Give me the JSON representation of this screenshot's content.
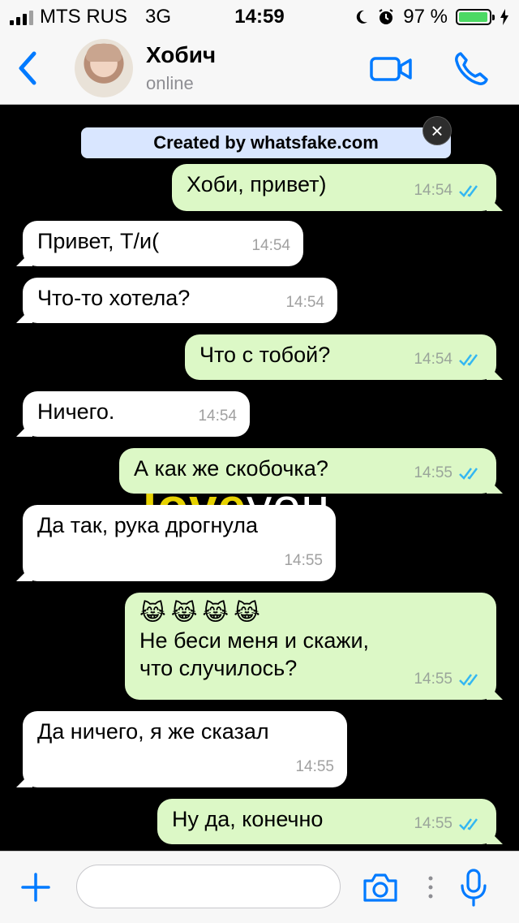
{
  "status_bar": {
    "carrier": "MTS RUS",
    "network": "3G",
    "time": "14:59",
    "battery_percent": "97 %",
    "battery_level": 0.97
  },
  "header": {
    "contact_name": "Хобич",
    "contact_status": "online"
  },
  "chat": {
    "banner": "Created by whatsfake.com",
    "wallpaper_text_1": "love",
    "wallpaper_text_2": "you",
    "messages": [
      {
        "direction": "out",
        "text": "Хоби, привет)",
        "time": "14:54",
        "read": true
      },
      {
        "direction": "in",
        "text": "Привет, Т/и(",
        "time": "14:54"
      },
      {
        "direction": "in",
        "text": "Что-то хотела?",
        "time": "14:54"
      },
      {
        "direction": "out",
        "text": "Что с тобой?",
        "time": "14:54",
        "read": true
      },
      {
        "direction": "in",
        "text": "Ничего.",
        "time": "14:54"
      },
      {
        "direction": "out",
        "text": "А как же скобочка?",
        "time": "14:55",
        "read": true
      },
      {
        "direction": "in",
        "text": "Да так, рука дрогнула",
        "time": "14:55"
      },
      {
        "direction": "out",
        "emoji": "😹😹😹😹",
        "line1": "Не беси меня и скажи,",
        "line2": "что случилось?",
        "time": "14:55",
        "read": true
      },
      {
        "direction": "in",
        "text": "Да ничего, я же сказал",
        "time": "14:55"
      },
      {
        "direction": "out",
        "text": "Ну да, конечно",
        "time": "14:55",
        "read": true
      }
    ]
  },
  "input_bar": {
    "message_value": ""
  },
  "colors": {
    "accent": "#007aff",
    "outgoing_bubble": "#dcf8c6",
    "incoming_bubble": "#ffffff",
    "read_ticks": "#34b7f1",
    "chat_background": "#000000",
    "banner_background": "#d9e6ff"
  },
  "icons": [
    "signal-icon",
    "moon-icon",
    "alarm-icon",
    "battery-icon",
    "charging-icon",
    "back-chevron-icon",
    "video-call-icon",
    "phone-icon",
    "close-icon",
    "double-check-icon",
    "plus-icon",
    "camera-icon",
    "more-dots-icon",
    "microphone-icon"
  ]
}
